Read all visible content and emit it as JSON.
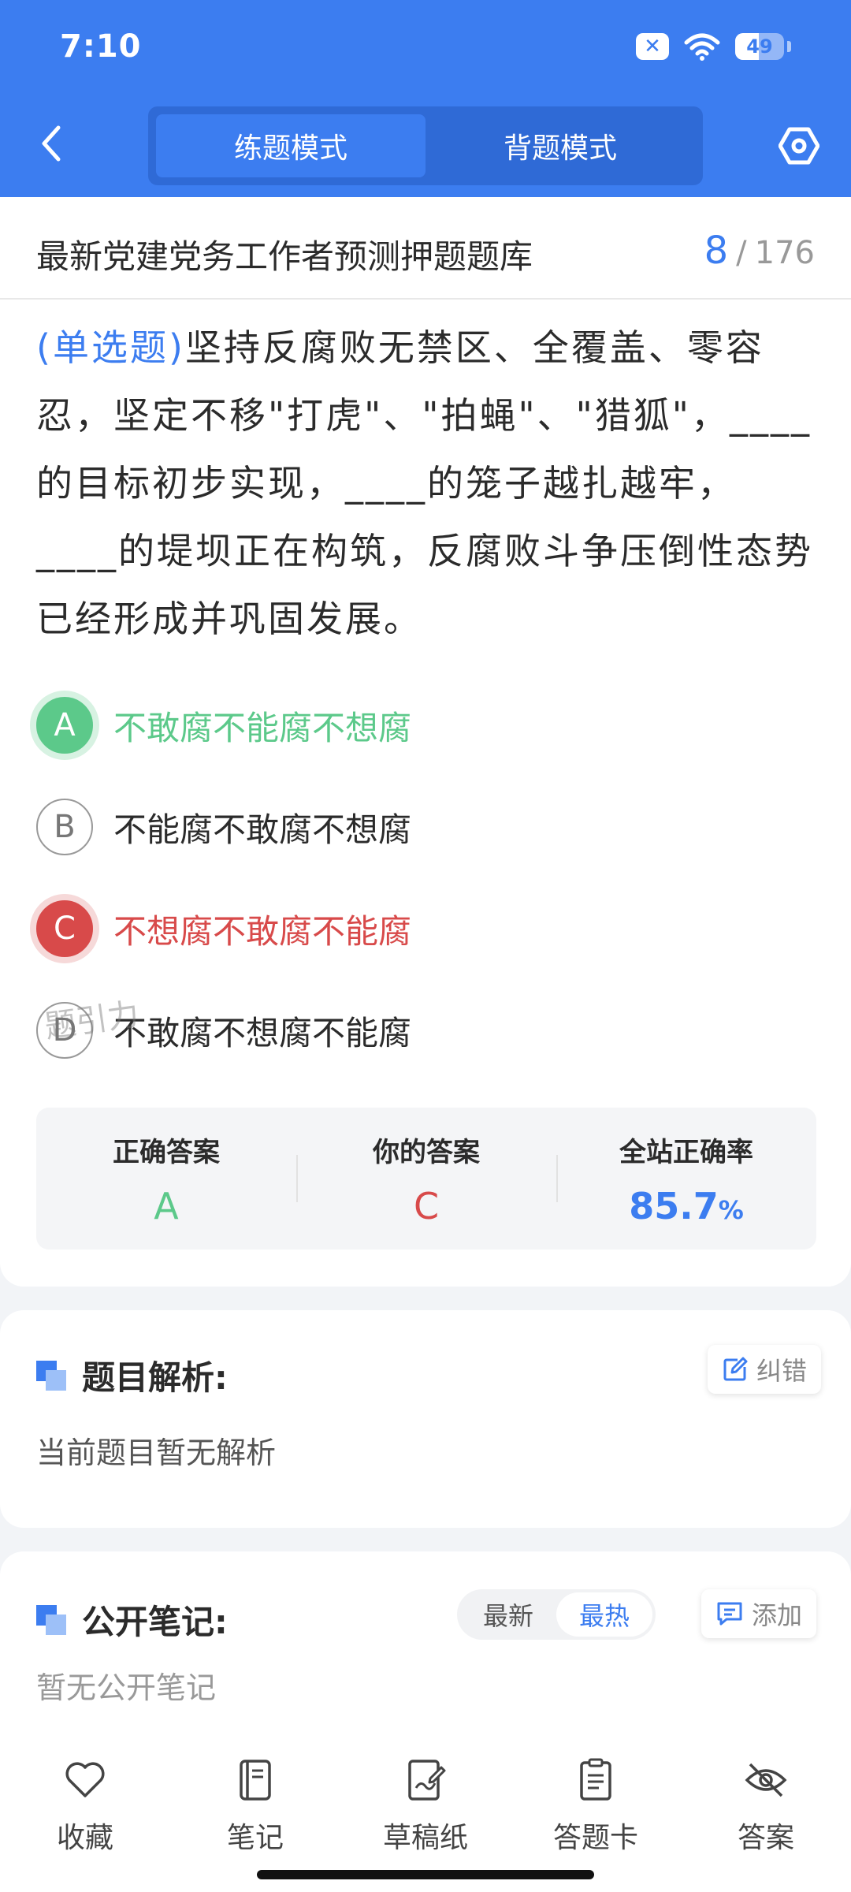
{
  "status_bar": {
    "time": "7:10",
    "battery": "49",
    "battery_level": 0.49
  },
  "header": {
    "tabs": [
      {
        "label": "练题模式",
        "active": true
      },
      {
        "label": "背题模式",
        "active": false
      }
    ]
  },
  "question_bank": {
    "title": "最新党建党务工作者预测押题题库",
    "current": "8",
    "separator": "/",
    "total": "176"
  },
  "question": {
    "type": "(单选题)",
    "text": "坚持反腐败无禁区、全覆盖、零容忍，坚定不移\"打虎\"、\"拍蝇\"、\"猎狐\"，____的目标初步实现，____的笼子越扎越牢，____的堤坝正在构筑，反腐败斗争压倒性态势已经形成并巩固发展。"
  },
  "options": [
    {
      "letter": "A",
      "text": "不敢腐不能腐不想腐",
      "state": "correct"
    },
    {
      "letter": "B",
      "text": "不能腐不敢腐不想腐",
      "state": "normal"
    },
    {
      "letter": "C",
      "text": "不想腐不敢腐不能腐",
      "state": "wrong"
    },
    {
      "letter": "D",
      "text": "不敢腐不想腐不能腐",
      "state": "normal"
    }
  ],
  "watermark": "题引力",
  "answer_summary": {
    "correct_label": "正确答案",
    "correct_value": "A",
    "your_label": "你的答案",
    "your_value": "C",
    "rate_label": "全站正确率",
    "rate_value": "85.7",
    "rate_unit": "%"
  },
  "analysis": {
    "title": "题目解析:",
    "correct_button": "纠错",
    "body": "当前题目暂无解析"
  },
  "notes": {
    "title": "公开笔记:",
    "sort_options": [
      {
        "label": "最新",
        "active": false
      },
      {
        "label": "最热",
        "active": true
      }
    ],
    "add_button": "添加",
    "body": "暂无公开笔记"
  },
  "bottom_nav": [
    {
      "label": "收藏",
      "icon": "heart-icon"
    },
    {
      "label": "笔记",
      "icon": "notebook-icon"
    },
    {
      "label": "草稿纸",
      "icon": "draft-paper-icon"
    },
    {
      "label": "答题卡",
      "icon": "answer-sheet-icon"
    },
    {
      "label": "答案",
      "icon": "eye-off-icon"
    }
  ],
  "colors": {
    "primary": "#3c7df0",
    "correct": "#5cc98a",
    "wrong": "#d84a4a"
  }
}
